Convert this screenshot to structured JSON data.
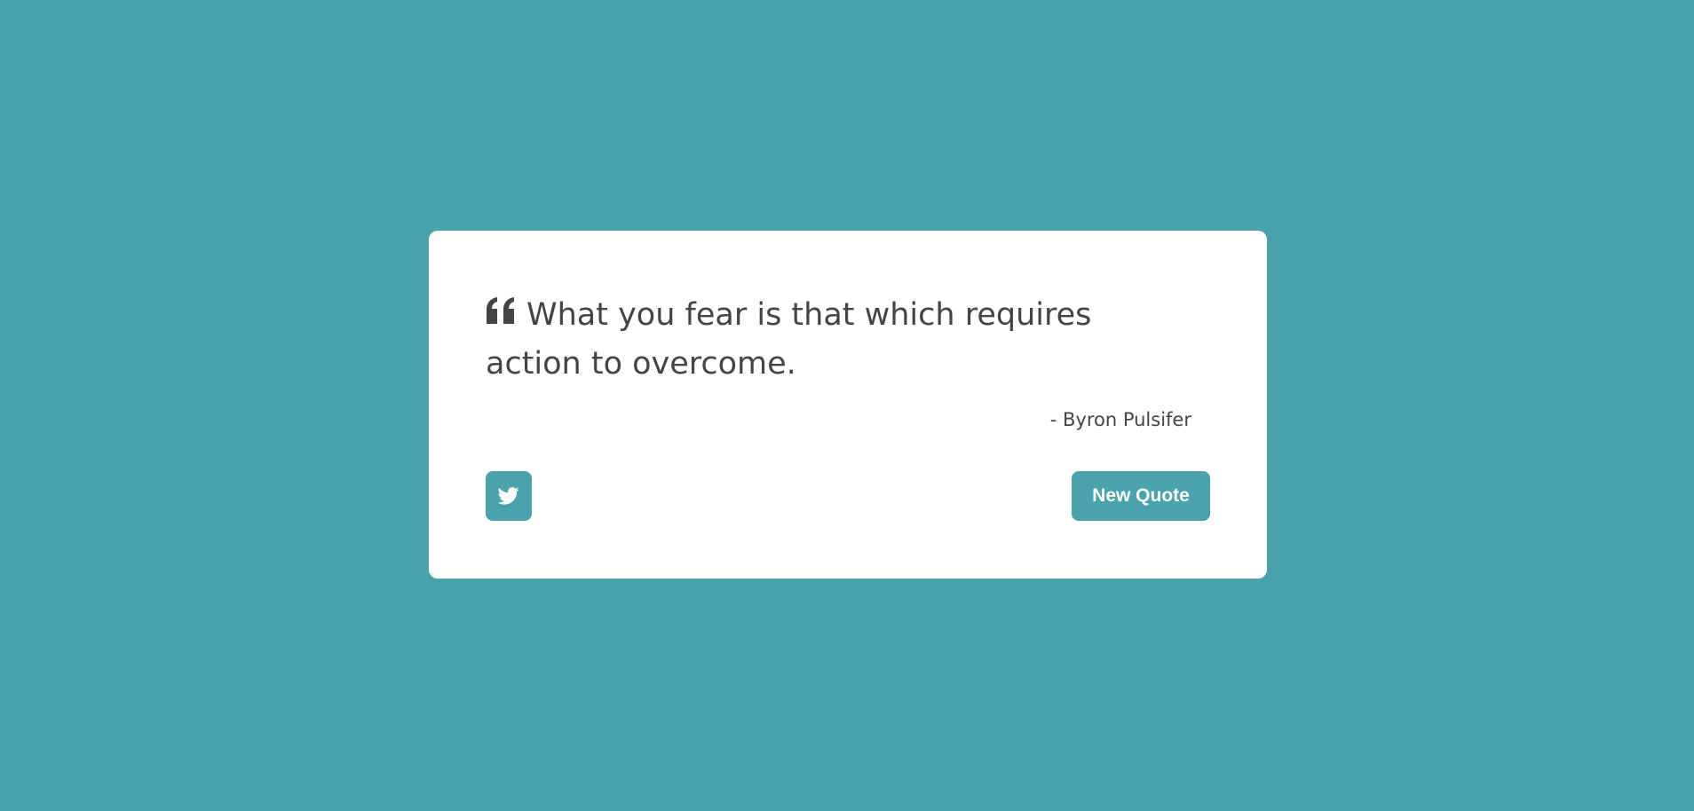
{
  "theme": {
    "background": "#4aa3ac",
    "card": "#ffffff",
    "text": "#444444",
    "button_text": "#ffffff"
  },
  "quote": {
    "text": "What you fear is that which requires action to overcome.",
    "author": "- Byron Pulsifer",
    "quote_icon": "quote-left-icon"
  },
  "actions": {
    "tweet_icon": "twitter-icon",
    "new_quote_label": "New Quote"
  }
}
